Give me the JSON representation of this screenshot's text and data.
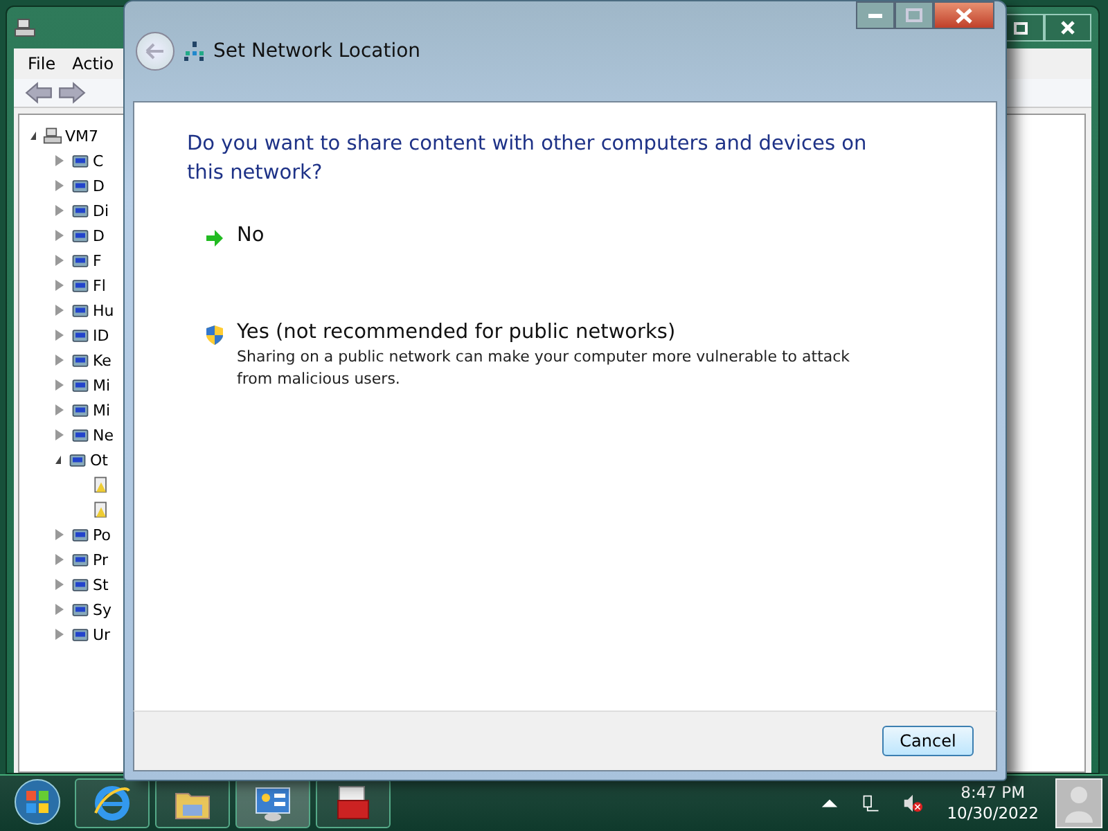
{
  "background_window": {
    "menu": [
      "File",
      "Actio"
    ],
    "tree": {
      "label": "VM7",
      "expanded": true,
      "children": [
        {
          "label": "C",
          "expanded": false
        },
        {
          "label": "D",
          "expanded": false
        },
        {
          "label": "Di",
          "expanded": false
        },
        {
          "label": "D",
          "expanded": false
        },
        {
          "label": "F",
          "expanded": false
        },
        {
          "label": "Fl",
          "expanded": false
        },
        {
          "label": "Hu",
          "expanded": false
        },
        {
          "label": "ID",
          "expanded": false
        },
        {
          "label": "Ke",
          "expanded": false
        },
        {
          "label": "Mi",
          "expanded": false
        },
        {
          "label": "Mi",
          "expanded": false
        },
        {
          "label": "Ne",
          "expanded": false
        },
        {
          "label": "Ot",
          "expanded": true
        },
        {
          "label": "Po",
          "expanded": false
        },
        {
          "label": "Pr",
          "expanded": false
        },
        {
          "label": "St",
          "expanded": false
        },
        {
          "label": "Sy",
          "expanded": false
        },
        {
          "label": "Ur",
          "expanded": false
        }
      ]
    }
  },
  "dialog": {
    "title": "Set Network Location",
    "question": "Do you want to share content with other computers and devices on this network?",
    "options": [
      {
        "kind": "arrow",
        "label": "No"
      },
      {
        "kind": "shield",
        "label": "Yes (not recommended for public networks)",
        "description": "Sharing on a public network can make your computer more vulnerable to attack from malicious users."
      }
    ],
    "buttons": [
      "Cancel"
    ]
  },
  "taskbar": {
    "clock_time": "8:47 PM",
    "clock_date": "10/30/2022"
  }
}
